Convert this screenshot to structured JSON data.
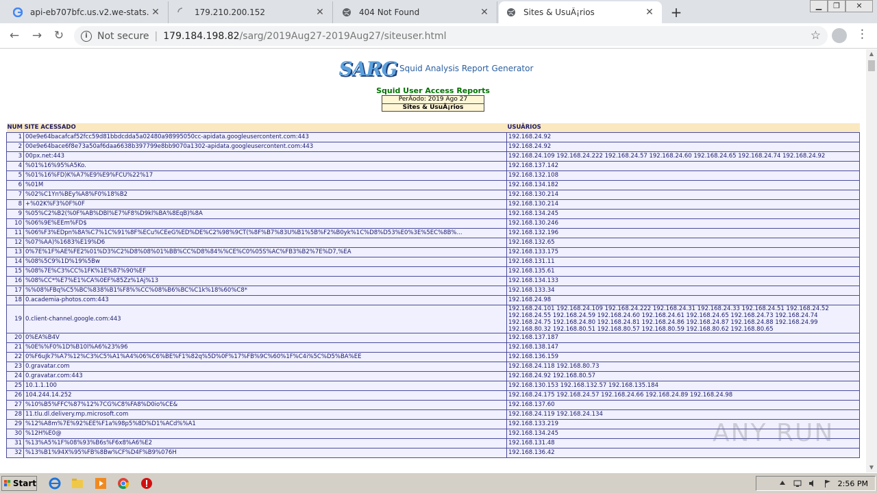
{
  "tabs": [
    {
      "title": "api-eb707bfc.us.v2.we-stats.com -",
      "icon": "google-icon"
    },
    {
      "title": "179.210.200.152",
      "icon": "loading-icon"
    },
    {
      "title": "404 Not Found",
      "icon": "globe-icon"
    },
    {
      "title": "Sites & UsuÃ¡rios",
      "icon": "globe-icon"
    }
  ],
  "omnibox": {
    "not_secure": "Not secure",
    "host": "179.184.198.82",
    "path": "/sarg/2019Aug27-2019Aug27/siteuser.html"
  },
  "page": {
    "logo_text": "SARG",
    "logo_caption": "Squid Analysis Report Generator",
    "report_title": "Squid User Access Reports",
    "period": "PerÃ­odo: 2019 Ago 27",
    "sites_label": "Sites & UsuÃ¡rios"
  },
  "table": {
    "headers": [
      "NUM",
      "SITE ACESSADO",
      "USUÃRIOS"
    ],
    "rows": [
      {
        "num": "1",
        "site": "00e9e64bacafcaf52fcc59d81bbdcdda5a02480a98995050cc-apidata.googleusercontent.com:443",
        "users": "192.168.24.92"
      },
      {
        "num": "2",
        "site": "00e9e64bace6f8e73a50af6daa6638b397799e8bb9070a1302-apidata.googleusercontent.com:443",
        "users": "192.168.24.92"
      },
      {
        "num": "3",
        "site": "00px.net:443",
        "users": "192.168.24.109 192.168.24.222 192.168.24.57 192.168.24.60 192.168.24.65 192.168.24.74 192.168.24.92"
      },
      {
        "num": "4",
        "site": "%01%16%95%A5Ko.",
        "users": "192.168.137.142"
      },
      {
        "num": "5",
        "site": "%01%16%FD)K%A7%E9%E9%FCU%22%17",
        "users": "192.168.132.108"
      },
      {
        "num": "6",
        "site": "%01M",
        "users": "192.168.134.182"
      },
      {
        "num": "7",
        "site": "%02%C1Yn%BEy%A8%F0%18%B2",
        "users": "192.168.130.214"
      },
      {
        "num": "8",
        "site": "+%02K%F3%0F%0F",
        "users": "192.168.130.214"
      },
      {
        "num": "9",
        "site": "%05%C2%B2(%0F%AB%DBl%E7%F8%D9kl%BA%8EqB)%8A",
        "users": "192.168.134.245"
      },
      {
        "num": "10",
        "site": "%06%9E%EEm%FD$",
        "users": "192.168.130.246"
      },
      {
        "num": "11",
        "site": "%06%F3%EDpn%8A%C7%1C%91%8F%ECu%CEeG%ED%DE%C2%98%9CT(%8F%B7%83U%B1%5B%F2%B0yk%1C%D8%D53%E0%3E%5EC%8B%...",
        "users": "192.168.132.196"
      },
      {
        "num": "12",
        "site": "%07%AA)%1683%E19%D6",
        "users": "192.168.132.65"
      },
      {
        "num": "13",
        "site": "0%7E%1F%AE%FE2%01%D3%C2%D8%08%01%BB%CC%D8%84%%CE%C0%05S%AC%FB3%B2%7E%D7,%EA",
        "users": "192.168.133.175"
      },
      {
        "num": "14",
        "site": "%08%5C9%1D%19%5Bw",
        "users": "192.168.131.11"
      },
      {
        "num": "15",
        "site": "%08%7E%C3%CC%1FK%1E%87%90%EF",
        "users": "192.168.135.61"
      },
      {
        "num": "16",
        "site": "%08%CC*%E7%E1%CA%0EF%85Zz%1Aj%13",
        "users": "192.168.134.133"
      },
      {
        "num": "17",
        "site": "%%08%FBq%C5%BC%838%B1%F8%%CC%08%B6%BC%C1k%18%60%C8*",
        "users": "192.168.133.34"
      },
      {
        "num": "18",
        "site": "0.academia-photos.com:443",
        "users": "192.168.24.98"
      },
      {
        "num": "19",
        "site": "0.client-channel.google.com:443",
        "users": "192.168.24.101 192.168.24.109 192.168.24.222 192.168.24.31 192.168.24.33 192.168.24.51 192.168.24.52 192.168.24.55 192.168.24.59 192.168.24.60 192.168.24.61 192.168.24.65 192.168.24.73 192.168.24.74 192.168.24.75 192.168.24.80 192.168.24.81 192.168.24.86 192.168.24.87 192.168.24.88 192.168.24.99 192.168.80.32 192.168.80.51 192.168.80.57 192.168.80.59 192.168.80.62 192.168.80.65"
      },
      {
        "num": "20",
        "site": "0%EA%B4V",
        "users": "192.168.137.187"
      },
      {
        "num": "21",
        "site": "%0E%%F0%1D%B10l%A6%23%96",
        "users": "192.168.138.147"
      },
      {
        "num": "22",
        "site": "0%F6uJk7%A7%12%C3%C5%A1%A4%06%C6%BE%F1%82q%5D%0F%17%FB%9C%60%1F%C4i%5C%D5%BA%EE",
        "users": "192.168.136.159"
      },
      {
        "num": "23",
        "site": "0.gravatar.com",
        "users": "192.168.24.118 192.168.80.73"
      },
      {
        "num": "24",
        "site": "0.gravatar.com:443",
        "users": "192.168.24.92 192.168.80.57"
      },
      {
        "num": "25",
        "site": "10.1.1.100",
        "users": "192.168.130.153 192.168.132.57 192.168.135.184"
      },
      {
        "num": "26",
        "site": "104.244.14.252",
        "users": "192.168.24.175 192.168.24.57 192.168.24.66 192.168.24.89 192.168.24.98"
      },
      {
        "num": "27",
        "site": "%10%B5%FFC%87%12%7CG%C8%FA8%D0io%CE&",
        "users": "192.168.137.60"
      },
      {
        "num": "28",
        "site": "11.tlu.dl.delivery.mp.microsoft.com",
        "users": "192.168.24.119 192.168.24.134"
      },
      {
        "num": "29",
        "site": "%12%A8m%7E%92%EE%F1a%98p5%8D%D1%ACd%%A1",
        "users": "192.168.133.219"
      },
      {
        "num": "30",
        "site": "%12H%E0@",
        "users": "192.168.134.245"
      },
      {
        "num": "31",
        "site": "%13%A5%1F%08%93%B6s%F6x8%A6%E2",
        "users": "192.168.131.48"
      },
      {
        "num": "32",
        "site": "%13%B1%94X%95%FB%8Bw%CF%D4F%B9%076H",
        "users": "192.168.136.42"
      }
    ]
  },
  "watermark": "ANY RUN",
  "taskbar": {
    "start": "Start",
    "clock": "2:56 PM"
  }
}
